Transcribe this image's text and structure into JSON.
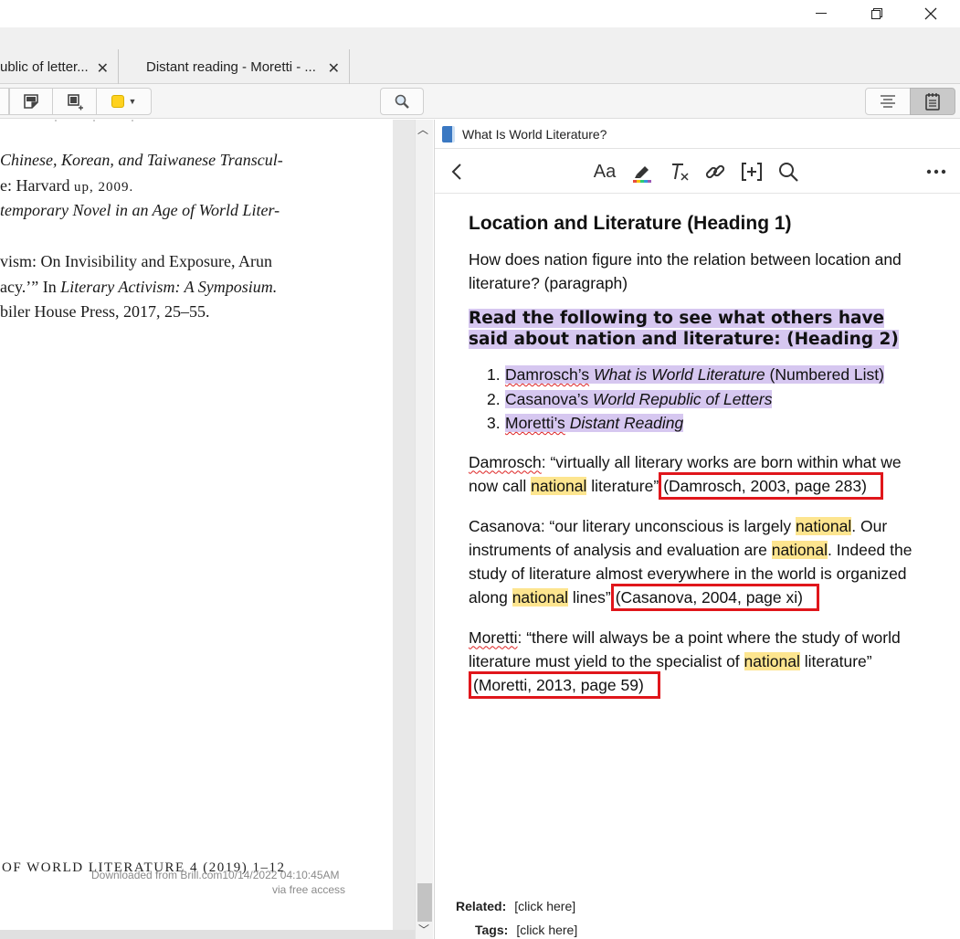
{
  "tabs": [
    {
      "label": "ublic of letter..."
    },
    {
      "label": "Distant reading - Moretti - ..."
    }
  ],
  "icons": {
    "close_tab": "✕",
    "search": "magnifier",
    "annotation_color": "#ffd21f"
  },
  "pdf": {
    "lines": [
      {
        "pre": "",
        "ital": "Chinese, Korean, and Taiwanese Transcul-",
        "post": ""
      },
      {
        "pre": "e: Harvard ",
        "ital": "",
        "post": "up, 2009."
      },
      {
        "pre": "",
        "ital": "temporary Novel in an Age of World Liter-",
        "post": ""
      },
      {
        "pre": "",
        "ital": "",
        "post": ""
      },
      {
        "pre": "vism: On Invisibility and Exposure, Arun",
        "ital": "",
        "post": ""
      },
      {
        "pre": "acy.’” In ",
        "ital": "Literary Activism: A Symposium.",
        "post": ""
      },
      {
        "pre": "biler House Press, 2017, 25–55.",
        "ital": "",
        "post": ""
      }
    ],
    "footer": "OF WORLD LITERATURE 4 (2019) 1–12",
    "download_text": "Downloaded from Brill.com10/14/2022 04:10:45AM",
    "access_text": "via free access"
  },
  "note": {
    "title": "What Is World Literature?",
    "heading1": "Location and Literature (Heading 1)",
    "intro": "How does nation figure into the relation between location and literature? (paragraph)",
    "heading2": "Read the following to see what others have said about nation and literature: (Heading 2)",
    "list": [
      {
        "num": "1.",
        "author": "Damrosch’s",
        "work": "What is World Literature",
        "suffix": " (Numbered List)"
      },
      {
        "num": "2.",
        "author": "Casanova’s",
        "work": "World Republic of Letters",
        "suffix": ""
      },
      {
        "num": "3.",
        "author": "Moretti’s",
        "work": "Distant Reading",
        "suffix": ""
      }
    ],
    "quotes": {
      "damrosch": {
        "author": "Damrosch",
        "t1": ": “virtually all literary works are born within what we now call ",
        "hl": "national",
        "t2": " literature”",
        "cite": "(Damrosch, 2003, page 283)"
      },
      "casanova": {
        "author": "Casanova",
        "t1": ": “our literary unconscious is largely ",
        "hl1": "national",
        "t2": ". Our instruments of analysis and evaluation are ",
        "hl2": "national",
        "t3": ". Indeed the study of literature almost everywhere in the world is organized along ",
        "hl3": "national",
        "t4": " lines”",
        "cite": "(Casanova, 2004, page xi)"
      },
      "moretti": {
        "author": "Moretti",
        "t1": ": “there will always be a point where the study of world literature must yield to the specialist of ",
        "hl": "national",
        "t2": " literature”",
        "cite": "(Moretti, 2013, page 59)"
      }
    },
    "related_label": "Related:",
    "related_value": "[click here]",
    "tags_label": "Tags:",
    "tags_value": "[click here]"
  }
}
